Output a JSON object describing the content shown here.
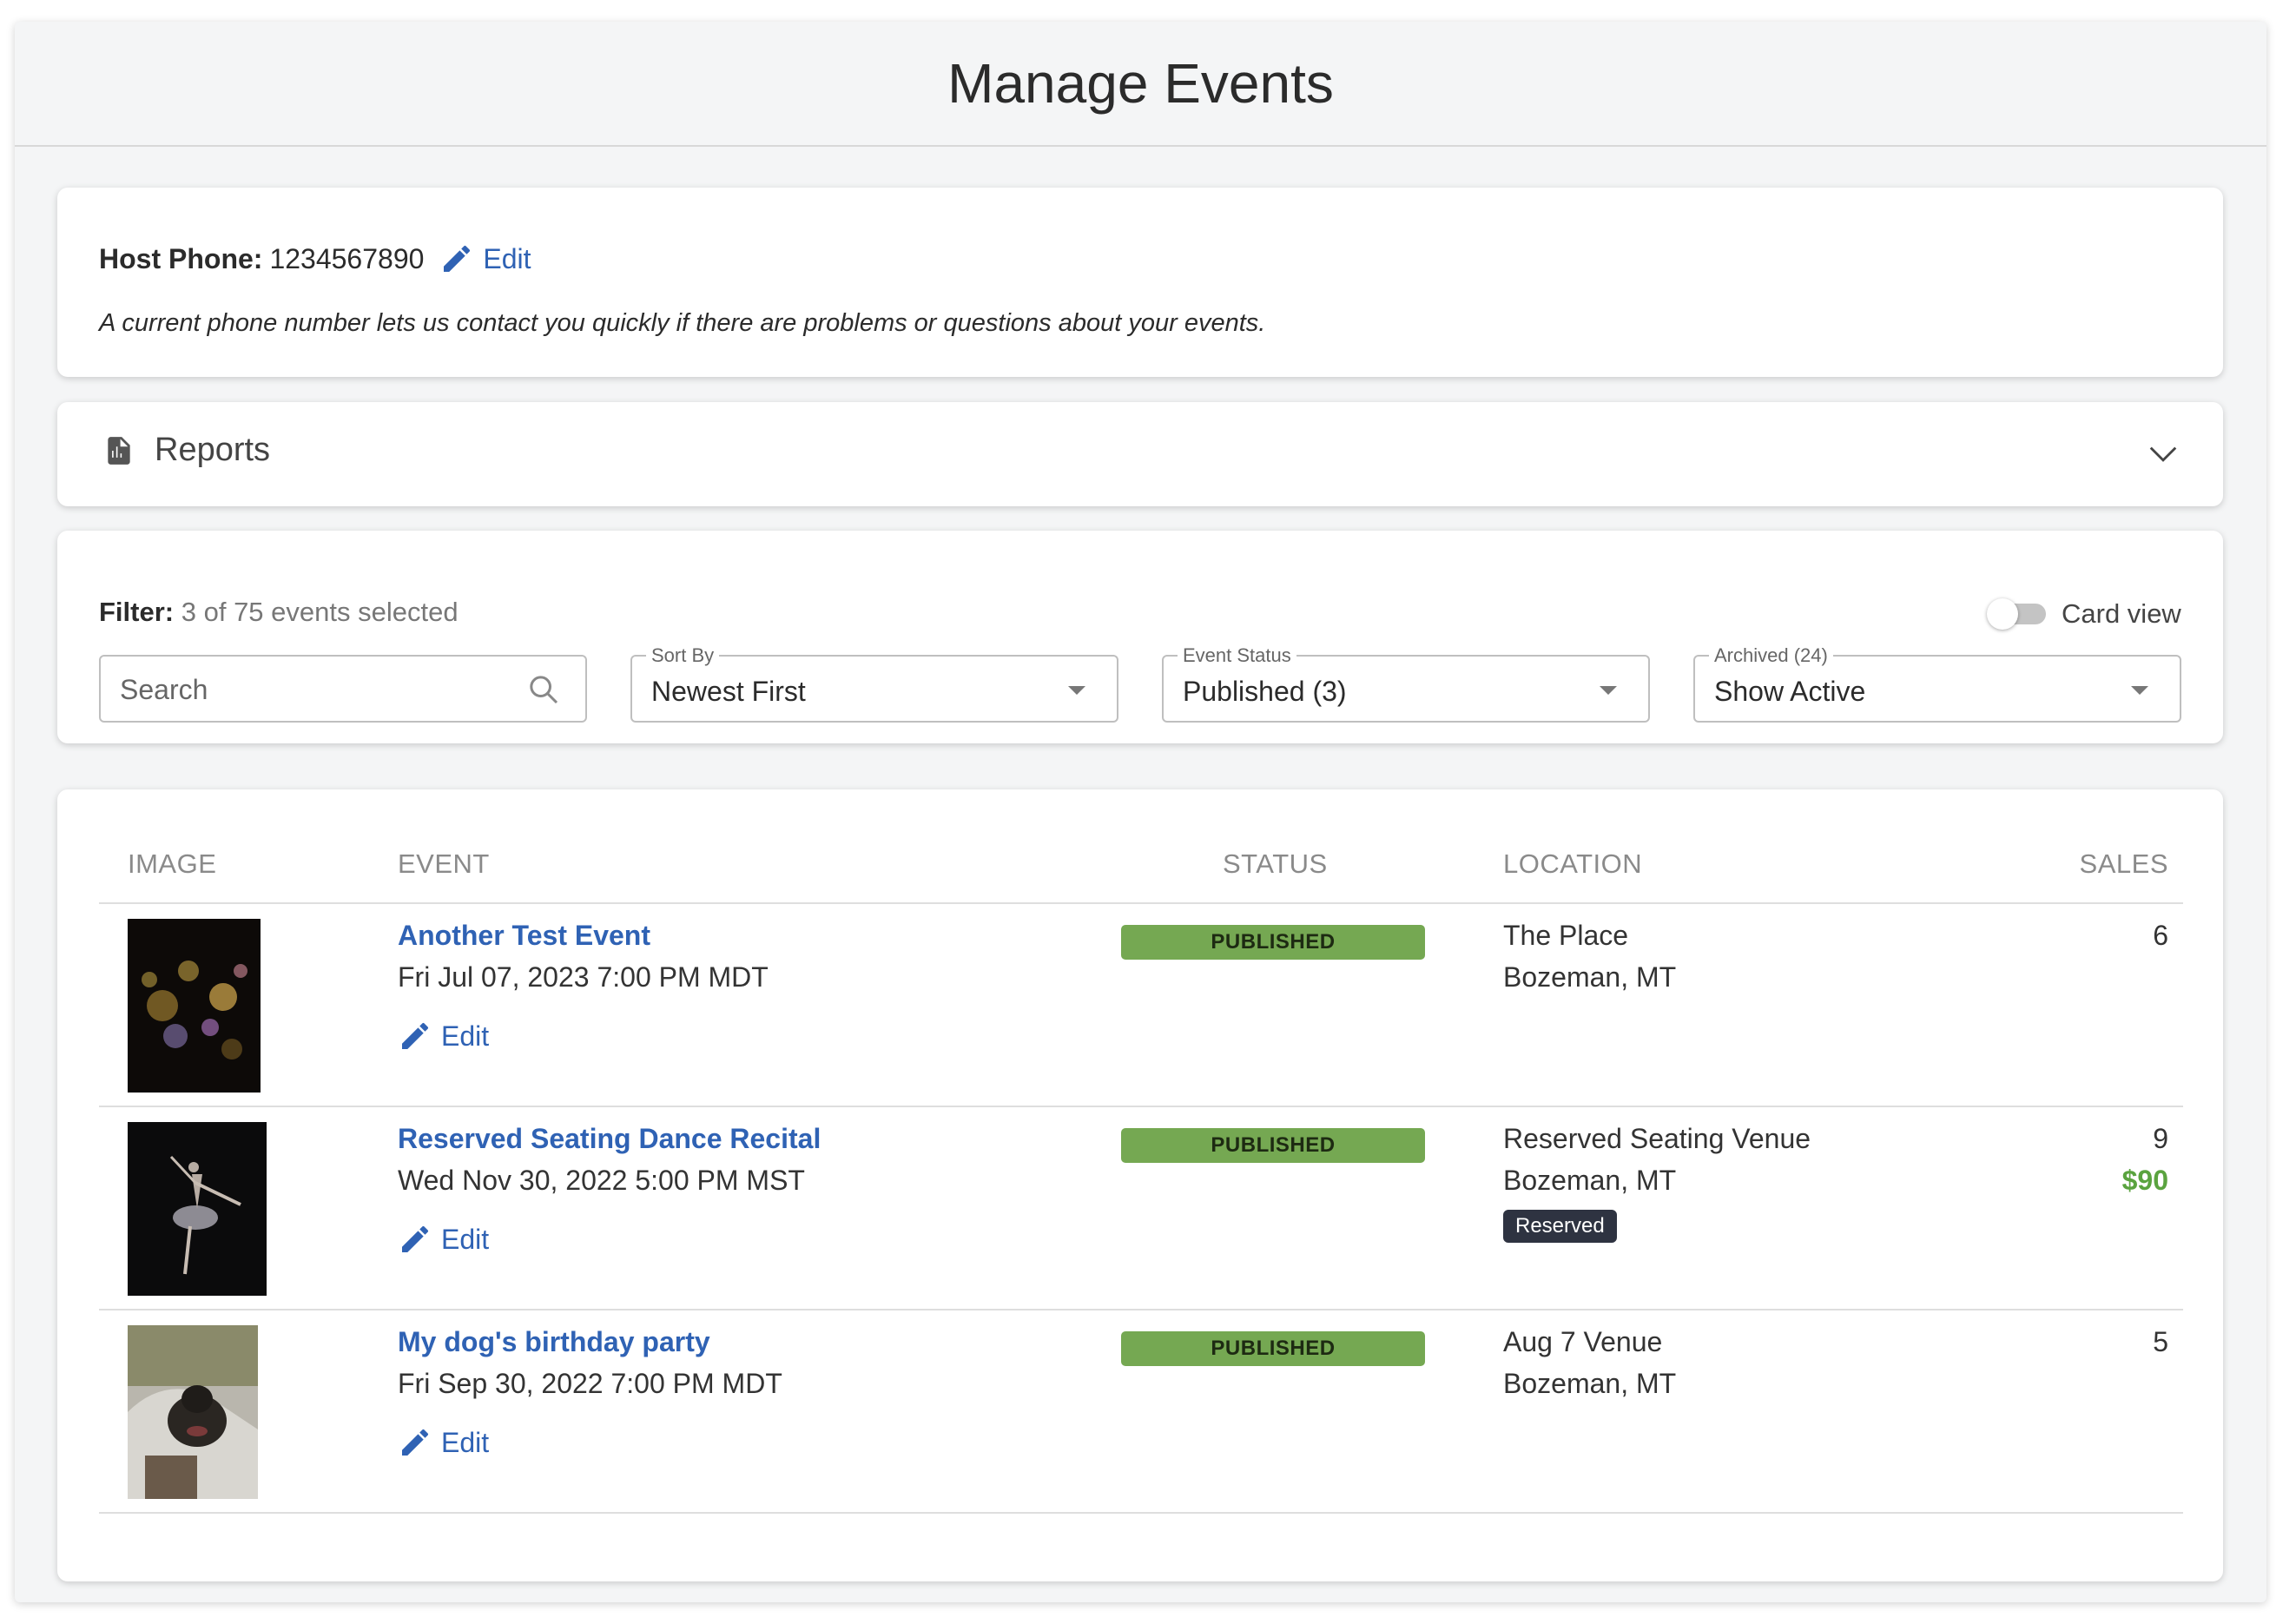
{
  "page": {
    "title": "Manage Events"
  },
  "host": {
    "label": "Host Phone:",
    "phone": "1234567890",
    "edit_label": "Edit",
    "note": "A current phone number lets us contact you quickly if there are problems or questions about your events."
  },
  "reports": {
    "label": "Reports"
  },
  "filter": {
    "label": "Filter:",
    "summary": "3 of 75 events selected",
    "card_view_label": "Card view",
    "card_view_on": false,
    "search": {
      "placeholder": "Search"
    },
    "sort": {
      "legend": "Sort By",
      "value": "Newest First"
    },
    "status": {
      "legend": "Event Status",
      "value": "Published (3)"
    },
    "archived": {
      "legend": "Archived (24)",
      "value": "Show Active"
    }
  },
  "table": {
    "columns": [
      "IMAGE",
      "EVENT",
      "STATUS",
      "LOCATION",
      "SALES"
    ],
    "rows": [
      {
        "title": "Another Test Event",
        "date": "Fri Jul 07, 2023 7:00 PM MDT",
        "edit": "Edit",
        "status": "PUBLISHED",
        "venue": "The Place",
        "city": "Bozeman, MT",
        "sales": "6",
        "image": "bokeh-lights-image"
      },
      {
        "title": "Reserved Seating Dance Recital",
        "date": "Wed Nov 30, 2022 5:00 PM MST",
        "edit": "Edit",
        "status": "PUBLISHED",
        "venue": "Reserved Seating Venue",
        "city": "Bozeman, MT",
        "tag": "Reserved",
        "sales": "9",
        "revenue": "$90",
        "image": "ballet-dancer-image"
      },
      {
        "title": "My dog's birthday party",
        "date": "Fri Sep 30, 2022 7:00 PM MDT",
        "edit": "Edit",
        "status": "PUBLISHED",
        "venue": "Aug 7 Venue",
        "city": "Bozeman, MT",
        "sales": "5",
        "image": "dog-photo-image"
      }
    ]
  },
  "colors": {
    "link": "#2f62b4",
    "published_badge": "#75a852",
    "revenue": "#5aa33f",
    "reserved_badge": "#2e3341"
  }
}
